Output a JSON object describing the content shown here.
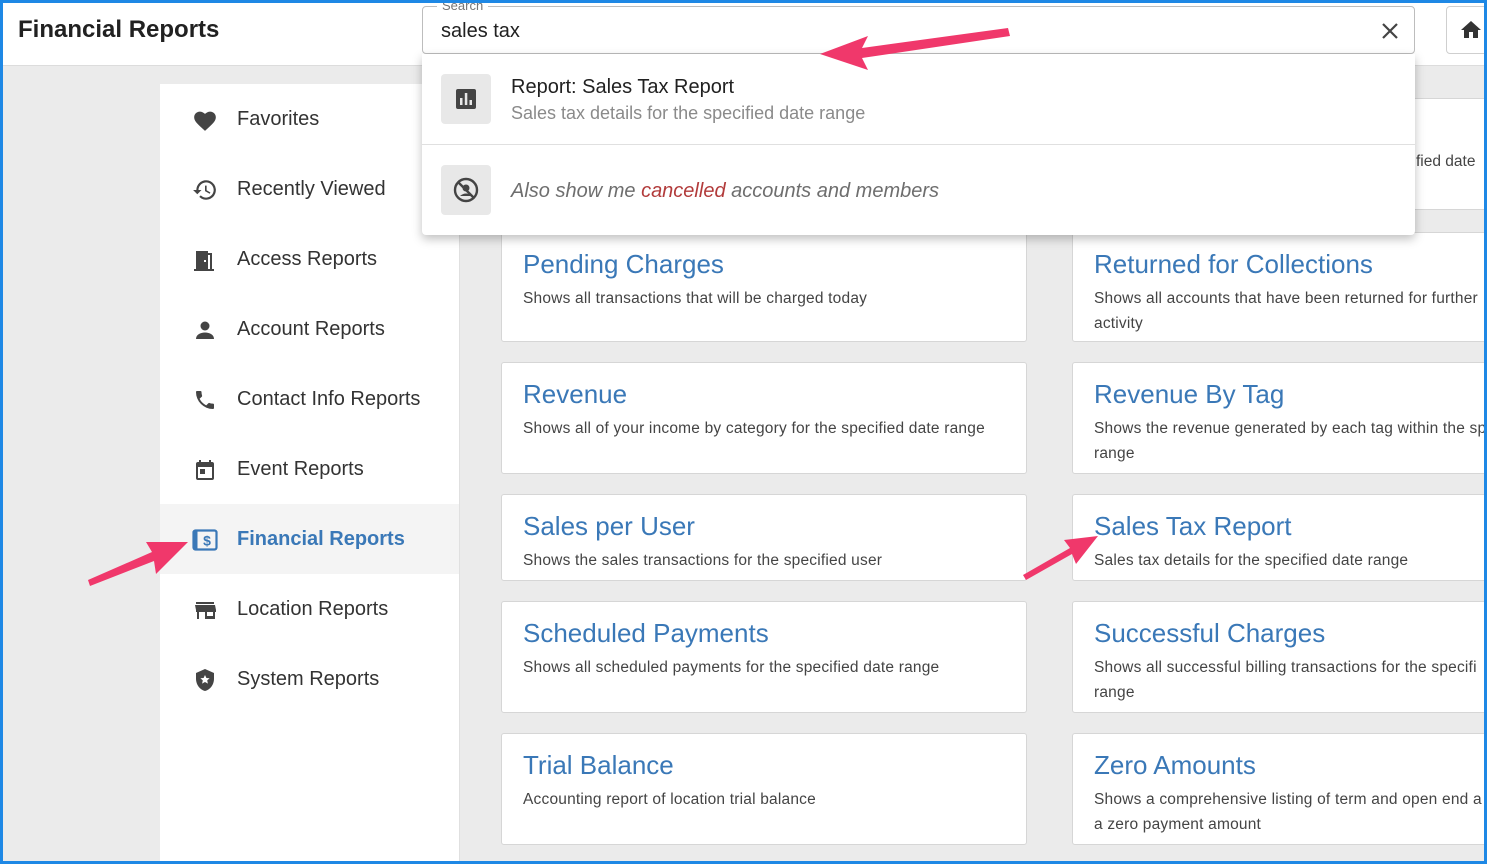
{
  "header": {
    "title": "Financial Reports"
  },
  "search": {
    "label": "Search",
    "value": "sales tax"
  },
  "dropdown": {
    "result": {
      "title": "Report: Sales Tax Report",
      "subtitle": "Sales tax details for the specified date range"
    },
    "cancelled": {
      "prefix": "Also show me ",
      "accent": "cancelled",
      "suffix": " accounts and members"
    }
  },
  "sidebar": {
    "items": [
      {
        "label": "Favorites",
        "icon": "heart-icon"
      },
      {
        "label": "Recently Viewed",
        "icon": "history-icon"
      },
      {
        "label": "Access Reports",
        "icon": "door-icon"
      },
      {
        "label": "Account Reports",
        "icon": "person-icon"
      },
      {
        "label": "Contact Info Reports",
        "icon": "phone-icon"
      },
      {
        "label": "Event Reports",
        "icon": "calendar-icon"
      },
      {
        "label": "Financial Reports",
        "icon": "dollar-icon",
        "active": true
      },
      {
        "label": "Location Reports",
        "icon": "store-icon"
      },
      {
        "label": "System Reports",
        "icon": "shield-icon"
      }
    ]
  },
  "peek": {
    "partial": "fied date"
  },
  "cards": {
    "pending": {
      "title": "Pending Charges",
      "desc": "Shows all transactions that will be charged today"
    },
    "returned": {
      "title": "Returned for Collections",
      "desc": "Shows all accounts that have been returned for further activity"
    },
    "revenue": {
      "title": "Revenue",
      "desc": "Shows all of your income by category for the specified date range"
    },
    "revenue_tag": {
      "title": "Revenue By Tag",
      "desc": "Shows the revenue generated by each tag within the sp range"
    },
    "sales_user": {
      "title": "Sales per User",
      "desc": "Shows the sales transactions for the specified user"
    },
    "sales_tax": {
      "title": "Sales Tax Report",
      "desc": "Sales tax details for the specified date range"
    },
    "scheduled": {
      "title": "Scheduled Payments",
      "desc": "Shows all scheduled payments for the specified date range"
    },
    "successful": {
      "title": "Successful Charges",
      "desc": "Shows all successful billing transactions for the specifi range"
    },
    "trial": {
      "title": "Trial Balance",
      "desc": "Accounting report of location trial balance"
    },
    "zero": {
      "title": "Zero Amounts",
      "desc": "Shows a comprehensive listing of term and open end a a zero payment amount"
    }
  },
  "colors": {
    "accent": "#3a78b7",
    "arrow": "#f0386b",
    "frame": "#1e88e5"
  }
}
